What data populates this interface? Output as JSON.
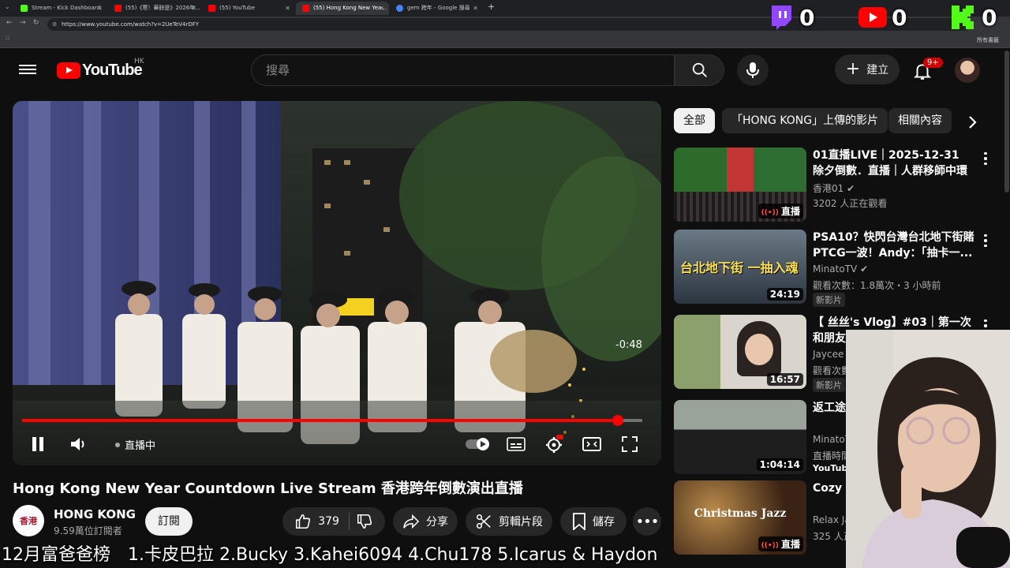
{
  "browser": {
    "tabs": [
      {
        "label": "Stream - Kick Dashboard",
        "active": false,
        "favicon_color": "#53fc18"
      },
      {
        "label": "(55)《寒！華餘是》2026年...",
        "active": false,
        "favicon_color": "#ff0000"
      },
      {
        "label": "(55) YouTube",
        "active": false,
        "favicon_color": "#ff0000"
      },
      {
        "label": "(55) Hong Kong New Yea...",
        "active": true,
        "favicon_color": "#ff0000"
      },
      {
        "label": "gem 跨年 - Google 搜尋",
        "active": false,
        "favicon_color": "#4285f4"
      }
    ],
    "new_tab": "+",
    "url": "https://www.youtube.com/watch?v=2UeTeV4rDFY",
    "bookmarks_right": "所有書籤"
  },
  "stream_counters": {
    "twitch": "0",
    "youtube": "0",
    "kick": "0",
    "colors": {
      "twitch": "#9146ff",
      "youtube": "#ff0000",
      "kick": "#53fc18"
    }
  },
  "header": {
    "logo_text": "YouTube",
    "country_code": "HK",
    "search_placeholder": "搜尋",
    "create_label": "建立",
    "notification_count": "9+"
  },
  "player": {
    "time_remaining": "-0:48",
    "live_label": "直播中",
    "progress_fraction": 0.96
  },
  "video": {
    "title": "Hong Kong New Year Countdown Live Stream 香港跨年倒數演出直播",
    "channel_name": "HONG KONG",
    "channel_avatar_text": "香港",
    "subscribers": "9.59萬位訂閱者",
    "subscribe_label": "訂閱",
    "likes": "379",
    "share_label": "分享",
    "clip_label": "剪輯片段",
    "save_label": "儲存"
  },
  "sidebar": {
    "chips": [
      "全部",
      "「HONG KONG」上傳的影片",
      "相關內容"
    ],
    "recommendations": [
      {
        "title": "01直播LIVE｜2025-12-31　除夕倒數．直播｜人群移師中環　8...",
        "channel": "香港01",
        "verified": true,
        "meta": "3202 人正在觀看",
        "badge": "直播",
        "live": true,
        "new": ""
      },
      {
        "title": "PSA10？快閃台灣台北地下街賭PTCG一波！Andy：「抽卡一...",
        "channel": "MinatoTV",
        "verified": true,
        "meta": "觀看次數：1.8萬次・3 小時前",
        "badge": "24:19",
        "live": false,
        "new": "新影片",
        "thumb_text": "台北地下街 一抽入魂"
      },
      {
        "title": "【 丝丝's Vlog】#03｜第一次和朋友去大旅行",
        "channel": "Jaycee",
        "verified": false,
        "meta": "觀看次數・29 分鐘前",
        "badge": "16:57",
        "live": false,
        "new": "新影片"
      },
      {
        "title": "返工途",
        "channel": "MinatoT",
        "verified": true,
        "meta": "直播時間",
        "badge": "1:04:14",
        "live": false,
        "new": "YouTube"
      },
      {
        "title": "Cozy C ❄ Swe",
        "channel": "Relax Ja",
        "verified": false,
        "meta": "325 人正",
        "badge": "直播",
        "live": true,
        "new": "",
        "thumb_text": "Christmas Jazz"
      }
    ]
  },
  "ticker": "12月富爸爸榜　1.卡皮巴拉 2.Bucky 3.Kahei6094 4.Chu178 5.Icarus & Haydon"
}
